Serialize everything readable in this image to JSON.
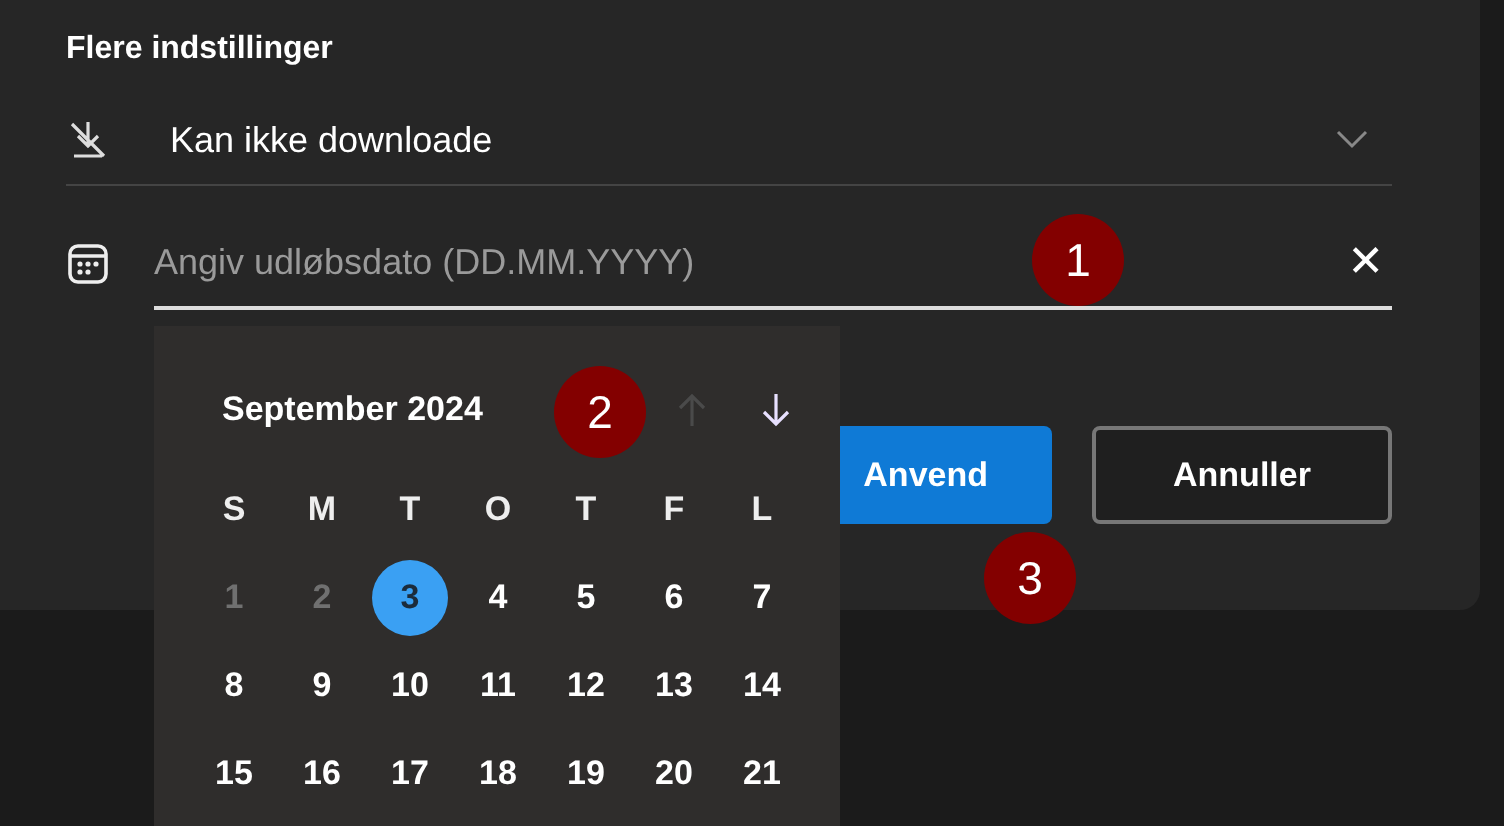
{
  "section_title": "Flere indstillinger",
  "download_select": {
    "value": "Kan ikke downloade"
  },
  "expiry_field": {
    "placeholder": "Angiv udløbsdato (DD.MM.YYYY)",
    "clear": "✕"
  },
  "buttons": [
    {
      "label": "Anvend",
      "kind": "primary"
    },
    {
      "label": "Annuller",
      "kind": "secondary"
    }
  ],
  "calendar": {
    "month": "September 2024",
    "nav": [
      {
        "kind": "up",
        "disabled": true
      },
      {
        "kind": "down",
        "disabled": false
      }
    ],
    "weekdays": [
      "S",
      "M",
      "T",
      "O",
      "T",
      "F",
      "L"
    ],
    "days": [
      {
        "label": "1",
        "disabled": true,
        "selected": false
      },
      {
        "label": "2",
        "disabled": true,
        "selected": false
      },
      {
        "label": "3",
        "disabled": false,
        "selected": true
      },
      {
        "label": "4",
        "disabled": false,
        "selected": false
      },
      {
        "label": "5",
        "disabled": false,
        "selected": false
      },
      {
        "label": "6",
        "disabled": false,
        "selected": false
      },
      {
        "label": "7",
        "disabled": false,
        "selected": false
      },
      {
        "label": "8",
        "disabled": false,
        "selected": false
      },
      {
        "label": "9",
        "disabled": false,
        "selected": false
      },
      {
        "label": "10",
        "disabled": false,
        "selected": false
      },
      {
        "label": "11",
        "disabled": false,
        "selected": false
      },
      {
        "label": "12",
        "disabled": false,
        "selected": false
      },
      {
        "label": "13",
        "disabled": false,
        "selected": false
      },
      {
        "label": "14",
        "disabled": false,
        "selected": false
      },
      {
        "label": "15",
        "disabled": false,
        "selected": false
      },
      {
        "label": "16",
        "disabled": false,
        "selected": false
      },
      {
        "label": "17",
        "disabled": false,
        "selected": false
      },
      {
        "label": "18",
        "disabled": false,
        "selected": false
      },
      {
        "label": "19",
        "disabled": false,
        "selected": false
      },
      {
        "label": "20",
        "disabled": false,
        "selected": false
      },
      {
        "label": "21",
        "disabled": false,
        "selected": false
      }
    ]
  },
  "callouts": [
    "1",
    "2",
    "3"
  ]
}
